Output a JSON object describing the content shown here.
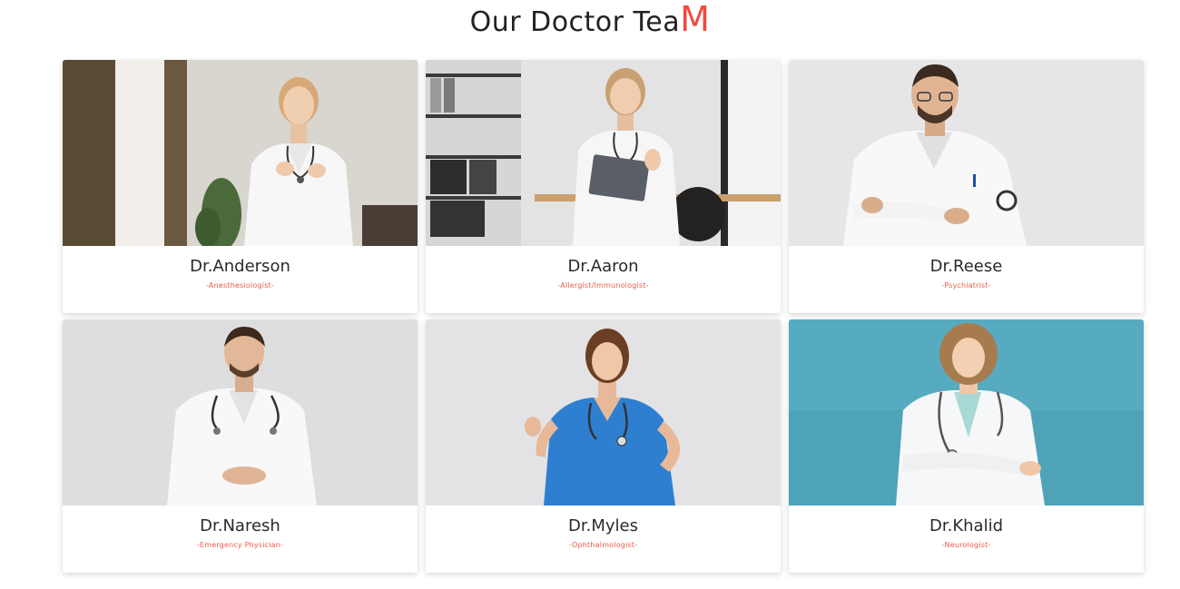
{
  "section": {
    "title_main": "Our Doctor Tea",
    "title_accent": "M"
  },
  "doctors": [
    {
      "name": "Dr.Anderson",
      "specialty": "-Anesthesiologist-"
    },
    {
      "name": "Dr.Aaron",
      "specialty": "-Allergist/Immunologist-"
    },
    {
      "name": "Dr.Reese",
      "specialty": "-Psychiatrist-"
    },
    {
      "name": "Dr.Naresh",
      "specialty": "-Emergency Physician-"
    },
    {
      "name": "Dr.Myles",
      "specialty": "-Ophthalmologist-"
    },
    {
      "name": "Dr.Khalid",
      "specialty": "-Neurologist-"
    }
  ],
  "colors": {
    "accent": "#ee4b3e",
    "specialty_text": "#ee5a45",
    "name_text": "#2a2a2a",
    "card_bg": "#ffffff"
  }
}
